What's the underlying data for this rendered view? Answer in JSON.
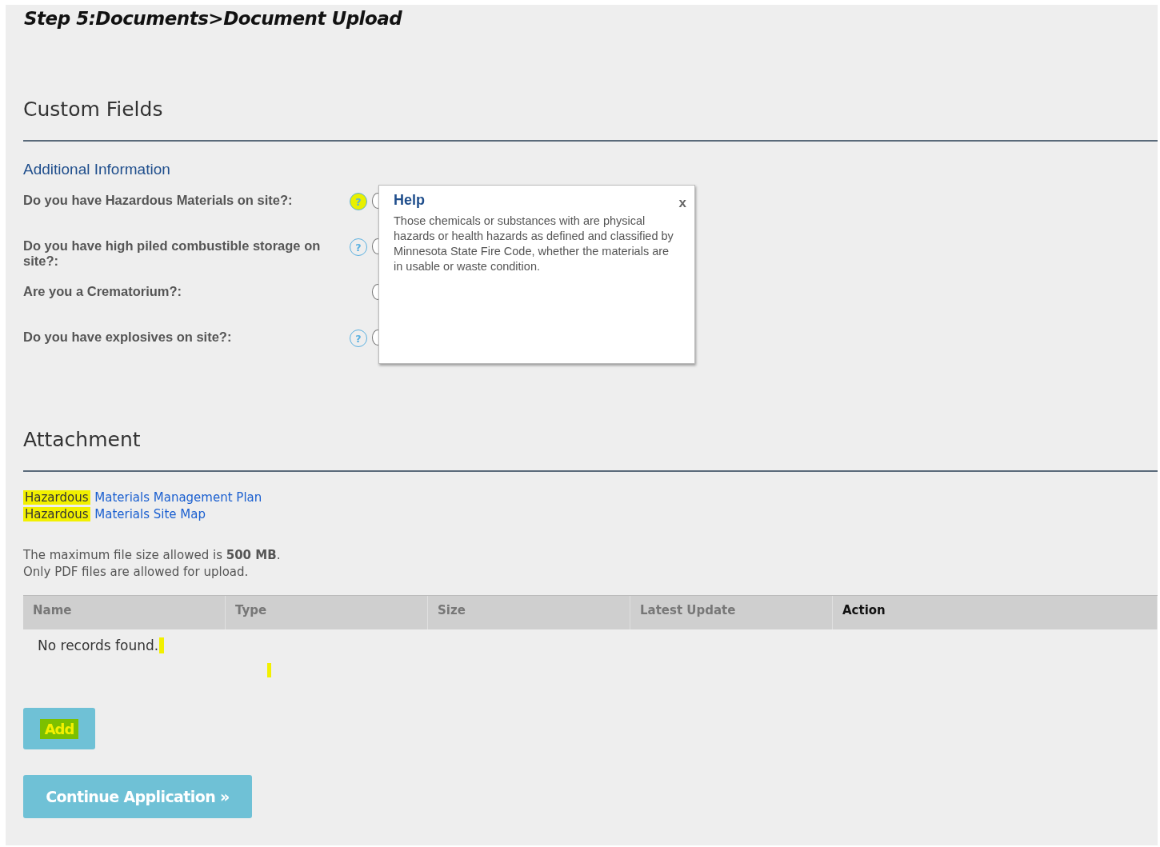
{
  "step_title": "Step 5:Documents>Document Upload",
  "custom_fields": {
    "heading": "Custom Fields",
    "subheading": "Additional Information",
    "fields": [
      {
        "label": "Do you have Hazardous Materials on site?:",
        "help_icon": {
          "glyph": "?",
          "highlighted": true
        },
        "radio_selected": false
      },
      {
        "label": "Do you have high piled combustible storage on site?:",
        "help_icon": {
          "glyph": "?",
          "highlighted": false
        },
        "radio_selected": false
      },
      {
        "label": "Are you a Crematorium?:",
        "radio_selected": false
      },
      {
        "label": "Do you have explosives on site?:",
        "help_icon": {
          "glyph": "?",
          "highlighted": false
        },
        "radio_selected": false
      }
    ]
  },
  "help_popup": {
    "title": "Help",
    "close": "x",
    "text": "Those chemicals or substances with are physical hazards or health hazards as defined and classified by Minnesota State Fire Code, whether the materials are in usable or waste condition."
  },
  "attachment": {
    "heading": "Attachment",
    "links": [
      {
        "marked": "Hazardous",
        "text": "Materials Management Plan"
      },
      {
        "marked": "Hazardous",
        "text": "Materials Site Map"
      }
    ],
    "notes": [
      "The maximum file size allowed is **500 MB**.",
      "Only PDF files are allowed for upload."
    ],
    "table": {
      "columns": [
        {
          "label": "Name",
          "bold": false
        },
        {
          "label": "Type",
          "bold": false
        },
        {
          "label": "Size",
          "bold": false
        },
        {
          "label": "Latest Update",
          "bold": false
        },
        {
          "label": "Action",
          "bold": true
        }
      ],
      "empty_message": "No records found.",
      "empty_marked": true,
      "stray_mark": true
    },
    "add_button": {
      "label": "Add",
      "highlighted": true
    }
  },
  "continue_button": {
    "label": "Continue Application »"
  }
}
